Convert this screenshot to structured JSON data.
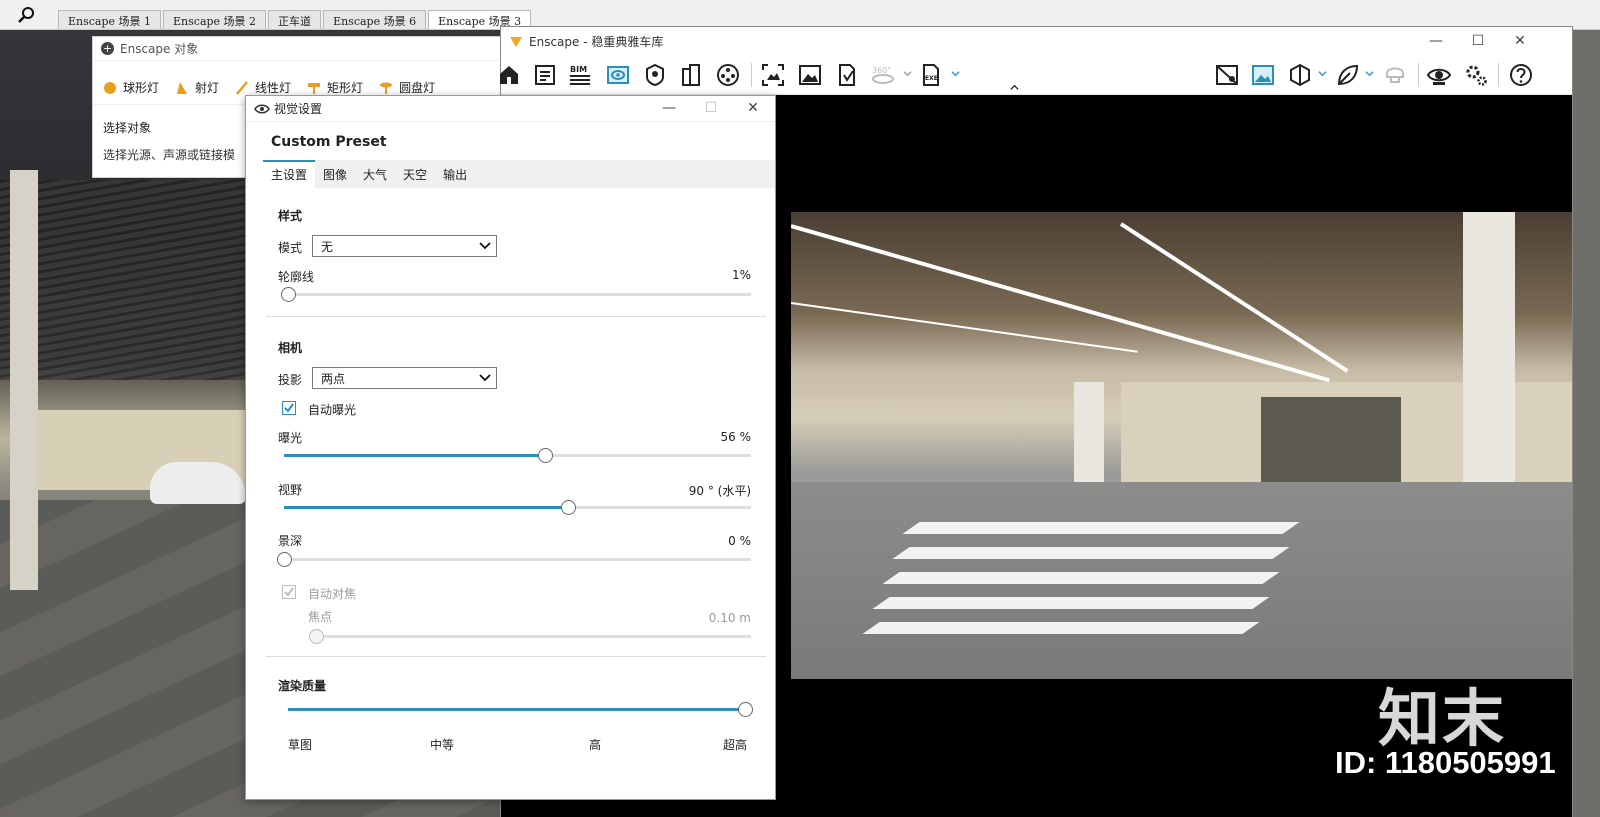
{
  "sketchup": {
    "scene_tabs": [
      "Enscape 场景 1",
      "Enscape 场景 2",
      "正车道",
      "Enscape 场景 6",
      "Enscape 场景 3"
    ],
    "active_tab_index": 4
  },
  "objects_panel": {
    "title": "Enscape 对象",
    "lights": [
      "球形灯",
      "射灯",
      "线性灯",
      "矩形灯",
      "圆盘灯"
    ],
    "select_title": "选择对象",
    "select_desc": "选择光源、声源或链接模"
  },
  "enscape_window": {
    "title": "Enscape - 稳重典雅车库",
    "toolbar_icons": [
      "home-icon",
      "notes-icon",
      "bim-icon",
      "view-icon",
      "asset-library-icon",
      "building-icon",
      "video-icon",
      "screenshot-icon",
      "image-icon",
      "batch-render-icon",
      "panorama-360-icon",
      "exe-export-icon",
      "collaborative-icon",
      "screenshot-mode-icon",
      "cube-icon",
      "leaf-icon",
      "vr-headset-icon",
      "visual-settings-icon",
      "settings-icon",
      "help-icon"
    ],
    "bim_label": "BIM",
    "exe_label": "EXE",
    "pano_label": "360°"
  },
  "visual_settings": {
    "title": "视觉设置",
    "preset_name": "Custom Preset",
    "tabs": [
      "主设置",
      "图像",
      "大气",
      "天空",
      "输出"
    ],
    "active_tab": 0,
    "style_section": "样式",
    "mode_label": "模式",
    "mode_value": "无",
    "outline_label": "轮廓线",
    "outline_value": "1%",
    "outline_pct": 1,
    "camera_section": "相机",
    "projection_label": "投影",
    "projection_value": "两点",
    "auto_exposure_label": "自动曝光",
    "auto_exposure_checked": true,
    "exposure_label": "曝光",
    "exposure_value": "56 %",
    "exposure_pct": 56,
    "fov_label": "视野",
    "fov_value": "90 ° (水平)",
    "fov_pct": 61,
    "dof_label": "景深",
    "dof_value": "0 %",
    "dof_pct": 0,
    "auto_focus_label": "自动对焦",
    "auto_focus_checked": true,
    "focus_label": "焦点",
    "focus_value": "0.10 m",
    "render_quality_section": "渲染质量",
    "quality_levels": [
      "草图",
      "中等",
      "高",
      "超高"
    ],
    "quality_index": 3
  },
  "watermark": {
    "logo": "知末",
    "id_text": "ID: 1180505991"
  },
  "colors": {
    "accent": "#2a8fbd",
    "enscape_orange": "#f5a623"
  }
}
